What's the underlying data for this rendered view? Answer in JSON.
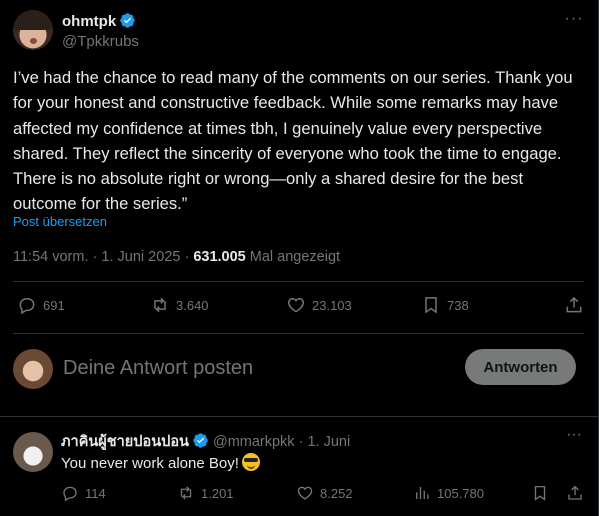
{
  "post": {
    "author_name": "ohmtpk",
    "author_handle": "@Tpkkrubs",
    "text": "I’ve had the chance to read many of the comments on our series. Thank you for your honest and constructive feedback. While some remarks may have affected my confidence at times tbh, I genuinely value every perspective shared. They reflect the sincerity of everyone who took the time to engage. There is no absolute right or wrong—only a shared desire for the best outcome for the series.”",
    "translate_label": "Post übersetzen",
    "time": "11:54 vorm.",
    "separator": "·",
    "date": "1. Juni 2025",
    "views_count": "631.005",
    "views_label": "Mal angezeigt",
    "more_icon": "more-horizontal-icon",
    "actions": {
      "replies": "691",
      "reposts": "3.640",
      "likes": "23.103",
      "bookmarks": "738"
    }
  },
  "composer": {
    "placeholder": "Deine Antwort posten",
    "button_label": "Antworten"
  },
  "reply": {
    "author_name": "ภาคินผู้ชายปอนปอน",
    "author_handle": "@mmarkpkk",
    "separator": "·",
    "date": "1. Juni",
    "text": "You never work alone Boy!",
    "emoji": "smiling-face-with-sunglasses",
    "actions": {
      "replies": "114",
      "reposts": "1.201",
      "likes": "8.252",
      "views": "105.780"
    }
  },
  "colors": {
    "background": "#000000",
    "text": "#e7e9ea",
    "muted": "#71767b",
    "accent": "#1d9bf0",
    "border": "#2f3336",
    "verified": "#1d9bf0"
  }
}
